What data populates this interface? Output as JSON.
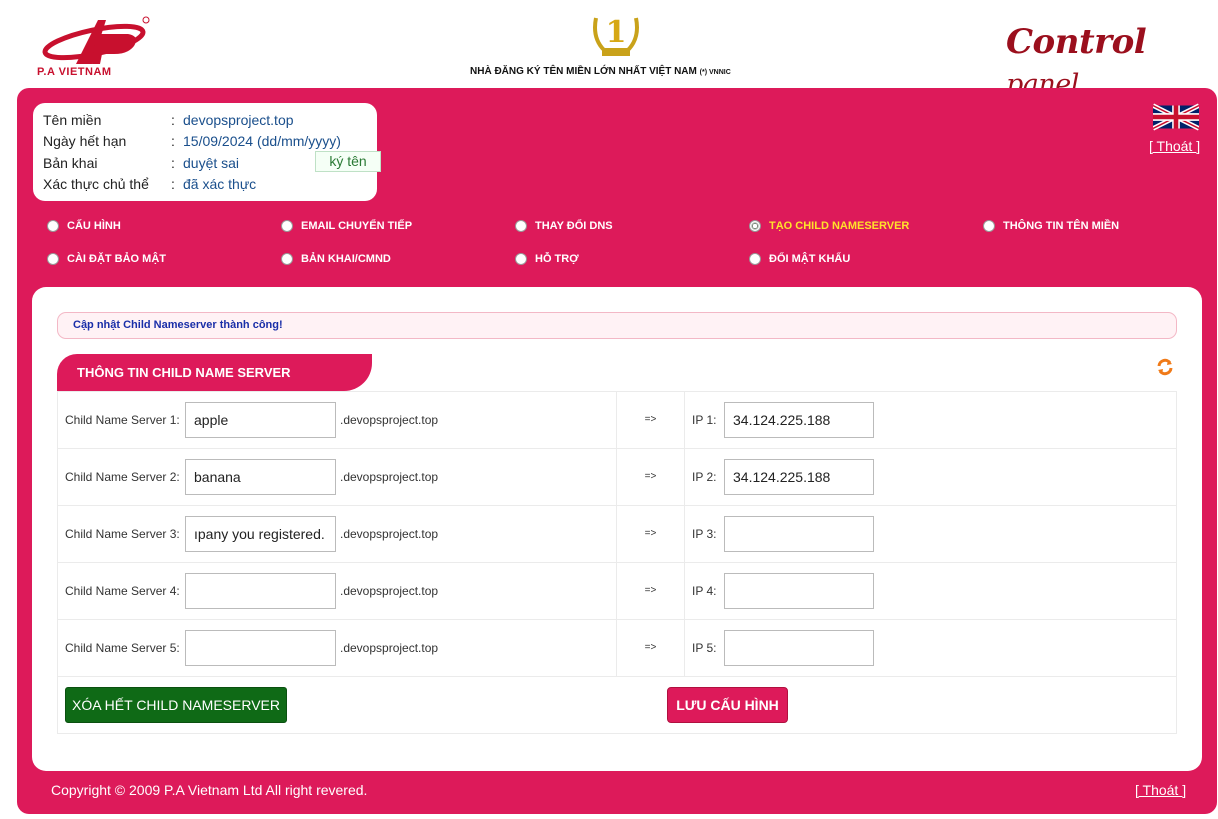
{
  "header": {
    "logo_text": "P.A VIETNAM",
    "award_numeral": "1",
    "tagline": "NHÀ ĐĂNG KÝ TÊN MIỀN LỚN NHẤT VIỆT NAM",
    "tagline_suffix": "(*) VNNIC",
    "cp_word1": "Control",
    "cp_word2": "panel"
  },
  "domain_info": {
    "rows": [
      {
        "label": "Tên miền",
        "sep": ":",
        "value": "devopsproject.top"
      },
      {
        "label": "Ngày hết hạn",
        "sep": ":",
        "value": "15/09/2024 (dd/mm/yyyy)"
      },
      {
        "label": "Bản khai",
        "sep": ":",
        "value": "duyệt sai"
      },
      {
        "label": "Xác thực chủ thể",
        "sep": ":",
        "value": "đã xác thực"
      }
    ],
    "sign_label": "ký tên"
  },
  "logout_label": "[ Thoát ]",
  "menu": [
    {
      "label": "CẤU HÌNH",
      "active": false
    },
    {
      "label": "EMAIL CHUYỂN TIẾP",
      "active": false
    },
    {
      "label": "THAY ĐỔI DNS",
      "active": false
    },
    {
      "label": "TẠO CHILD NAMESERVER",
      "active": true
    },
    {
      "label": "THÔNG TIN TÊN MIỀN",
      "active": false
    },
    {
      "label": "CÀI ĐẶT BẢO MẬT",
      "active": false
    },
    {
      "label": "BẢN KHAI/CMND",
      "active": false
    },
    {
      "label": "HỖ TRỢ",
      "active": false
    },
    {
      "label": "ĐỔI MẬT KHẨU",
      "active": false
    }
  ],
  "notice": "Cập nhật Child Nameserver thành công!",
  "section_title": "THÔNG TIN CHILD NAME SERVER",
  "domain_suffix": ".devopsproject.top",
  "arrow": "=>",
  "rows": [
    {
      "label": "Child Name Server 1:",
      "name": "apple",
      "ip_label": "IP 1:",
      "ip": "34.124.225.188"
    },
    {
      "label": "Child Name Server 2:",
      "name": "banana",
      "ip_label": "IP 2:",
      "ip": "34.124.225.188"
    },
    {
      "label": "Child Name Server 3:",
      "name": "ıpany you registered.",
      "ip_label": "IP 3:",
      "ip": ""
    },
    {
      "label": "Child Name Server 4:",
      "name": "",
      "ip_label": "IP 4:",
      "ip": ""
    },
    {
      "label": "Child Name Server 5:",
      "name": "",
      "ip_label": "IP 5:",
      "ip": ""
    }
  ],
  "buttons": {
    "clear": "XÓA HẾT CHILD NAMESERVER",
    "save": "LƯU CẤU HÌNH"
  },
  "footer": "Copyright © 2009 P.A Vietnam Ltd All right revered.",
  "colors": {
    "brand": "#dd1a5a",
    "active_menu": "#ffe32a",
    "clear_button": "#0f6a16",
    "link": "#1a4f8c"
  }
}
